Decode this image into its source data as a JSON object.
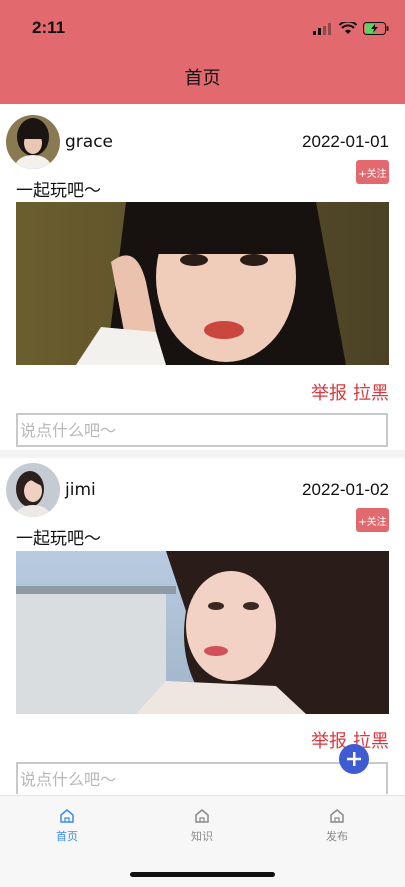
{
  "status": {
    "time": "2:11"
  },
  "nav": {
    "title": "首页"
  },
  "posts": [
    {
      "username": "grace",
      "date": "2022-01-01",
      "follow_label": "+关注",
      "caption": "一起玩吧～",
      "report_label": "举报",
      "block_label": "拉黑",
      "comment_placeholder": "说点什么吧～"
    },
    {
      "username": "jimi",
      "date": "2022-01-02",
      "follow_label": "+关注",
      "caption": "一起玩吧～",
      "report_label": "举报",
      "block_label": "拉黑",
      "comment_placeholder": "说点什么吧～"
    }
  ],
  "tabs": [
    {
      "label": "首页",
      "icon": "home-icon",
      "active": true
    },
    {
      "label": "知识",
      "icon": "home-icon",
      "active": false
    },
    {
      "label": "发布",
      "icon": "home-icon",
      "active": false
    }
  ],
  "colors": {
    "header": "#e26a6f",
    "accent_red": "#d9383f",
    "fab": "#3f5bd2",
    "tab_active": "#3a8ee6"
  }
}
